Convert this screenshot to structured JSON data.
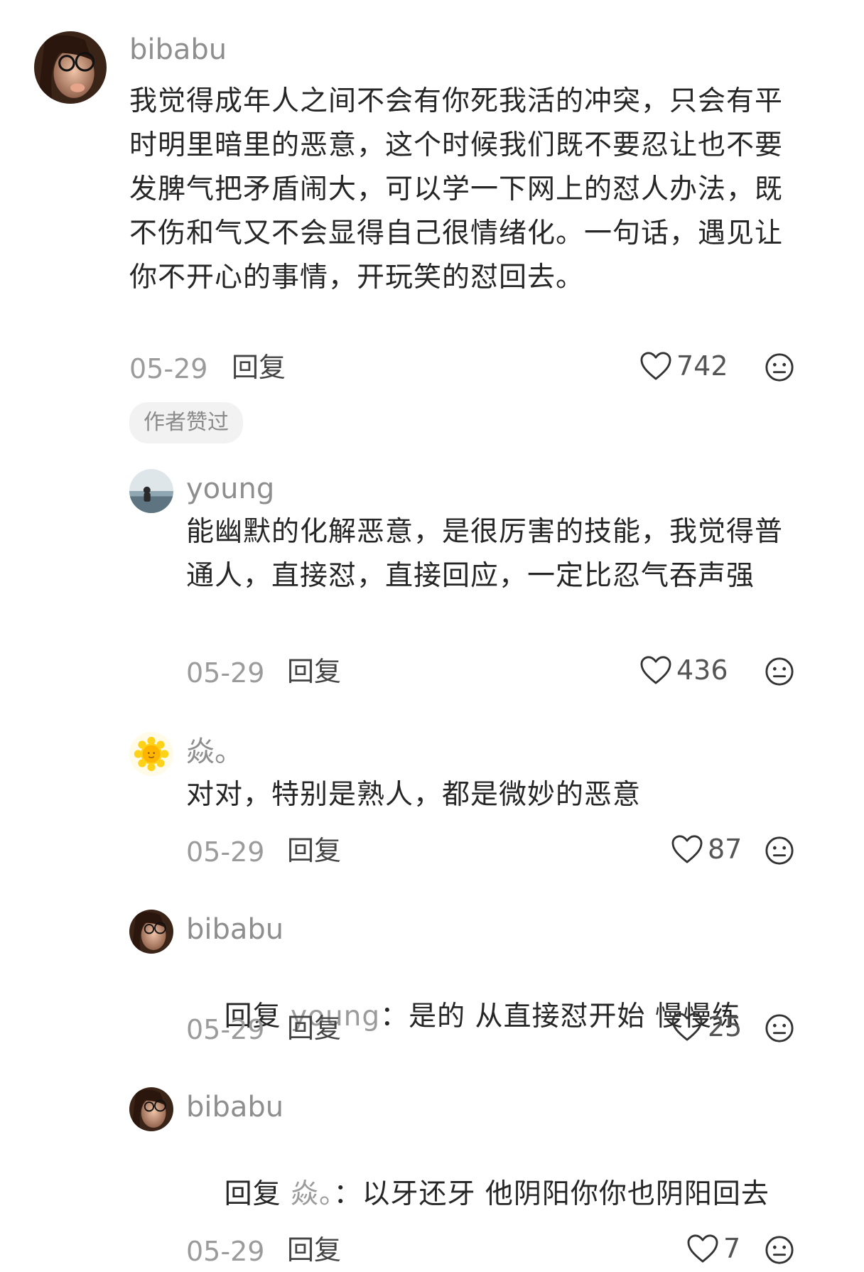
{
  "comments": [
    {
      "user": "bibabu",
      "text": "我觉得成年人之间不会有你死我活的冲突，只会有平时明里暗里的恶意，这个时候我们既不要忍让也不要发脾气把矛盾闹大，可以学一下网上的怼人办法，既不伤和气又不会显得自己很情绪化。一句话，遇见让你不开心的事情，开玩笑的怼回去。",
      "date": "05-29",
      "reply_label": "回复",
      "likes": "742",
      "badge": "作者赞过"
    }
  ],
  "replies": [
    {
      "user": "young",
      "text": "能幽默的化解恶意，是很厉害的技能，我觉得普通人，直接怼，直接回应，一定比忍气吞声强",
      "date": "05-29",
      "reply_label": "回复",
      "likes": "436"
    },
    {
      "user": "焱。",
      "text": "对对，特别是熟人，都是微妙的恶意",
      "date": "05-29",
      "reply_label": "回复",
      "likes": "87"
    },
    {
      "user": "bibabu",
      "reply_word": "回复",
      "reply_to": "young",
      "text": "：是的 从直接怼开始 慢慢练",
      "date": "05-29",
      "reply_label": "回复",
      "likes": "25"
    },
    {
      "user": "bibabu",
      "reply_word": "回复",
      "reply_to": "焱。",
      "text": "：以牙还牙 他阴阳你你也阴阳回去",
      "date": "05-29",
      "reply_label": "回复",
      "likes": "7"
    }
  ],
  "icons": {
    "like": "heart-outline-icon",
    "dislike": "neutral-face-icon"
  }
}
